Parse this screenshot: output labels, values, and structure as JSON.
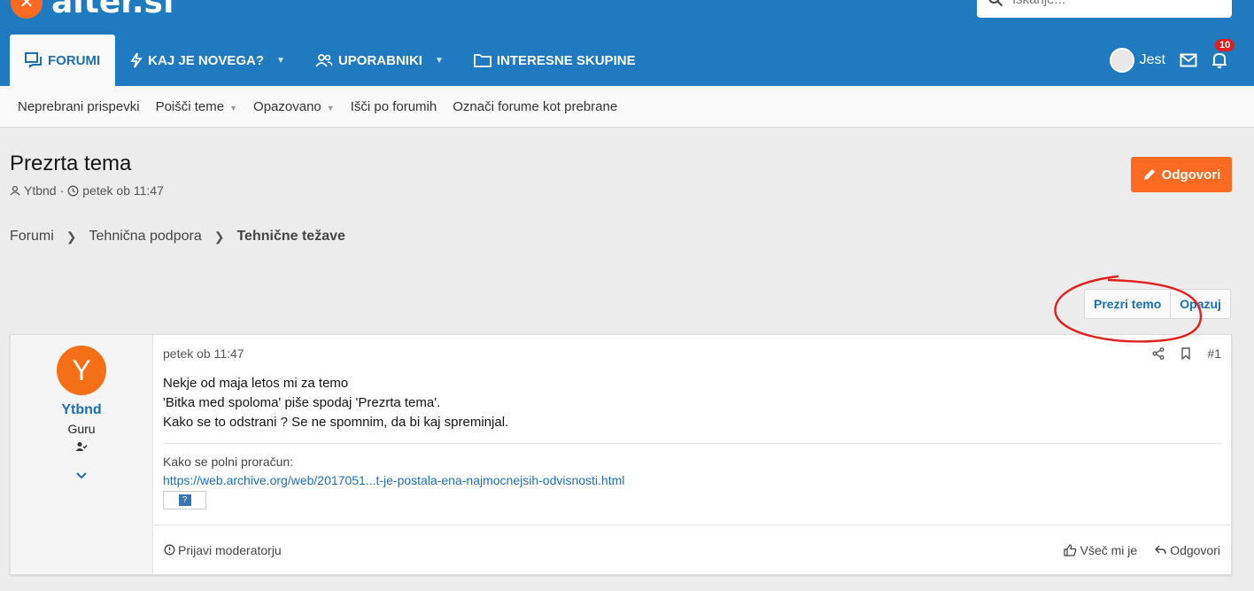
{
  "header": {
    "logo_text": "alter.si",
    "search": {
      "placeholder": "Iskanje..."
    },
    "nav": [
      {
        "label": "Forumi",
        "active": true
      },
      {
        "label": "Kaj je novega?",
        "has_menu": true
      },
      {
        "label": "Uporabniki",
        "has_menu": true
      },
      {
        "label": "Interesne skupine"
      }
    ],
    "user": {
      "name": "Jest"
    },
    "notifications_count": "10"
  },
  "subnav": [
    {
      "label": "Neprebrani prispevki"
    },
    {
      "label": "Poišči teme",
      "has_menu": true
    },
    {
      "label": "Opazovano",
      "has_menu": true
    },
    {
      "label": "Išči po forumih"
    },
    {
      "label": "Označi forume kot prebrane"
    }
  ],
  "thread": {
    "title": "Prezrta tema",
    "author": "Ytbnd",
    "date": "petek ob 11:47",
    "reply_label": "Odgovori"
  },
  "breadcrumb": [
    "Forumi",
    "Tehnična podpora",
    "Tehnične težave"
  ],
  "thread_actions": {
    "ignore": "Prezri temo",
    "watch": "Opazuj"
  },
  "post": {
    "user": {
      "initial": "Y",
      "name": "Ytbnd",
      "title": "Guru"
    },
    "date": "petek ob 11:47",
    "number": "#1",
    "body": [
      "Nekje od maja letos mi za temo",
      "'Bitka med spoloma' piše spodaj 'Prezrta tema'.",
      "Kako se to odstrani ? Se ne spomnim, da bi kaj spreminjal."
    ],
    "signature": {
      "label": "Kako se polni proračun:",
      "link": "https://web.archive.org/web/2017051...t-je-postala-ena-najmocnejsih-odvisnosti.html",
      "image_glyph": "?"
    },
    "footer": {
      "report": "Prijavi moderatorju",
      "like": "Všeč mi je",
      "reply": "Odgovori"
    }
  },
  "colors": {
    "header_bg": "#1f7ac0",
    "accent_orange": "#fd6b22",
    "link_blue": "#1f6fb0",
    "annotation_red": "#e0201b"
  }
}
